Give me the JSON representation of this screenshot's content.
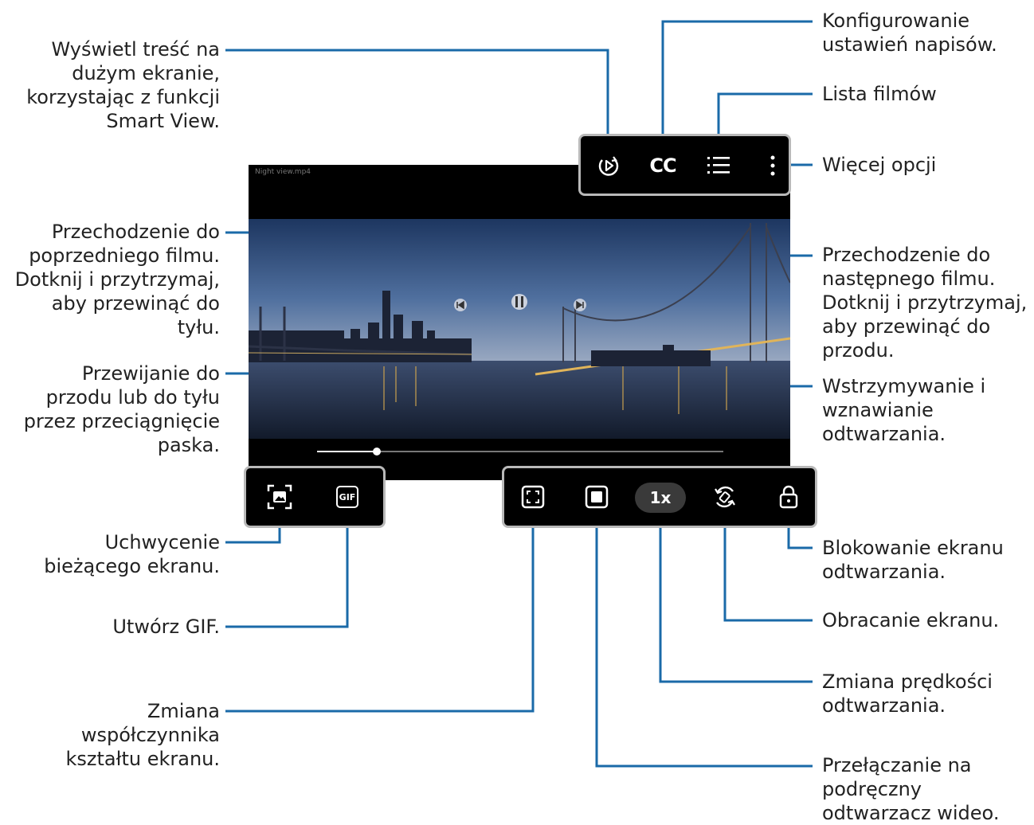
{
  "player": {
    "video_title": "Night view.mp4",
    "speed": "1x",
    "progress": 0.2
  },
  "callouts": {
    "smart_view": [
      "Wyświetl treść na",
      "dużym ekranie,",
      "korzystając z funkcji",
      "Smart View."
    ],
    "subtitles": [
      "Konfigurowanie",
      "ustawień napisów."
    ],
    "video_list": [
      "Lista filmów"
    ],
    "more_options": [
      "Więcej opcji"
    ],
    "previous": [
      "Przechodzenie do",
      "poprzedniego filmu.",
      "Dotknij i przytrzymaj,",
      "aby przewinąć do",
      "tyłu."
    ],
    "next": [
      "Przechodzenie do",
      "następnego filmu.",
      "Dotknij i przytrzymaj,",
      "aby przewinąć do",
      "przodu."
    ],
    "seek": [
      "Przewijanie do",
      "przodu lub do tyłu",
      "przez przeciągnięcie",
      "paska."
    ],
    "pause": [
      "Wstrzymywanie i",
      "wznawianie",
      "odtwarzania."
    ],
    "capture": [
      "Uchwycenie",
      "bieżącego ekranu."
    ],
    "gif": [
      "Utwórz GIF."
    ],
    "ratio": [
      "Zmiana",
      "współczynnika",
      "kształtu ekranu."
    ],
    "lock": [
      "Blokowanie ekranu",
      "odtwarzania."
    ],
    "rotate": [
      "Obracanie ekranu."
    ],
    "speed_change": [
      "Zmiana prędkości",
      "odtwarzania."
    ],
    "popup": [
      "Przełączanie na",
      "podręczny",
      "odtwarzacz wideo."
    ]
  },
  "icons": {
    "gif_label": "GIF",
    "cc_label": "CC"
  },
  "colors": {
    "leader_line": "#1a6aa8",
    "toolbar_border": "#b9b9b9"
  }
}
